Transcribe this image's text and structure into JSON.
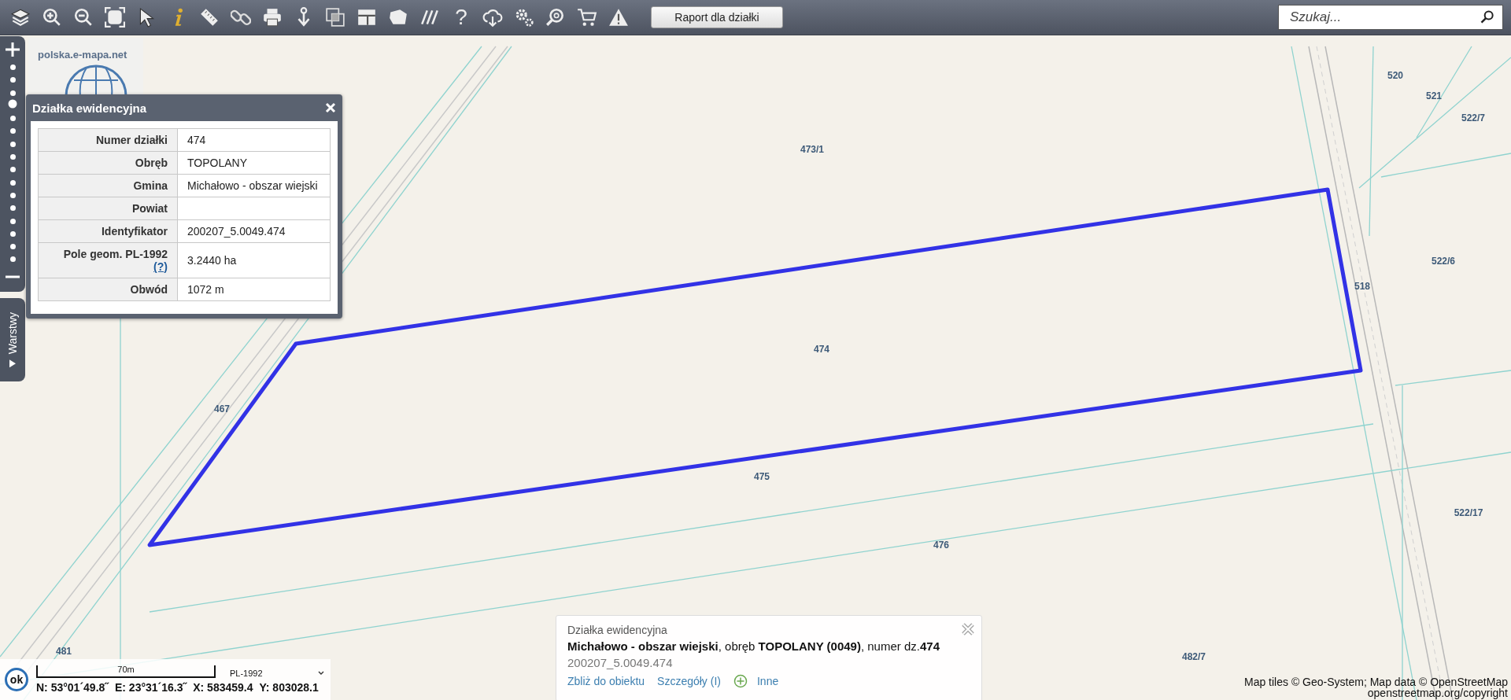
{
  "toolbar": {
    "help_label": "?",
    "report_button": "Raport dla działki",
    "search": {
      "placeholder": "Szukaj..."
    }
  },
  "zoom_bar": {
    "level": 0.8
  },
  "layers_tab": "Warstwy",
  "logo": "polska.e-mapa.net",
  "info_panel": {
    "title": "Działka ewidencyjna",
    "rows": [
      {
        "label": "Numer działki",
        "value": "474"
      },
      {
        "label": "Obręb",
        "value": "TOPOLANY"
      },
      {
        "label": "Gmina",
        "value": "Michałowo - obszar wiejski"
      },
      {
        "label": "Powiat"
      },
      {
        "label": "Identyfikator",
        "value": "200207_5.0049.474"
      },
      {
        "label": "Pole geom. PL-1992",
        "help": "(?)",
        "value": "3.2440 ha"
      },
      {
        "label": "Obwód",
        "value": "1072 m"
      }
    ]
  },
  "map": {
    "parcel_labels": [
      "520",
      "521",
      "522/7",
      "473/1",
      "522/6",
      "518",
      "474",
      "467",
      "475",
      "476",
      "522/17",
      "482/7",
      "481"
    ]
  },
  "info_box": {
    "title": "Działka ewidencyjna",
    "description": "**Michałowo - obszar wiejski**, obręb **TOPOLANY (0049)**, numer dz.**474**",
    "identifier": "200207_5.0049.474",
    "links": [
      "Zbliż do obiektu",
      "Szczegóły (I)"
    ],
    "more": "Inne"
  },
  "status": {
    "ok": "ok",
    "scale": "70m",
    "projection": "PL-1992",
    "coordinates": [
      "N: 53°01´49.8˝",
      "E: 23°31´16.3˝",
      "X: 583459.4",
      "Y: 803028.1"
    ]
  },
  "attribution": [
    "Map tiles © Geo-System; Map data © OpenStreetMap",
    "openstreetmap.org/copyright"
  ]
}
